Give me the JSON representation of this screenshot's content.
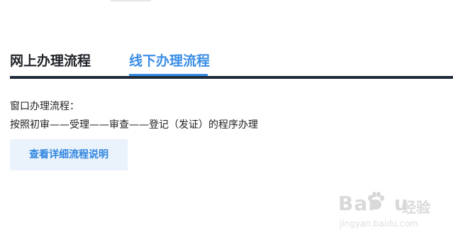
{
  "tabs": {
    "online_label": "网上办理流程",
    "offline_label": "线下办理流程"
  },
  "content": {
    "heading": "窗口办理流程：",
    "process": "按照初审——受理——审查——登记（发证）的程序办理"
  },
  "button": {
    "label": "查看详细流程说明"
  },
  "watermark": {
    "brand": "Bai",
    "brand_suffix": "u",
    "jingyan": "经验",
    "url": "jingyan.baidu.com"
  },
  "colors": {
    "accent": "#3a8ee6",
    "divider": "#1f2a37",
    "button_bg": "#eaf2fb",
    "text": "#222222"
  },
  "icons": {
    "watermark_logo": "baidu-paw-icon"
  }
}
